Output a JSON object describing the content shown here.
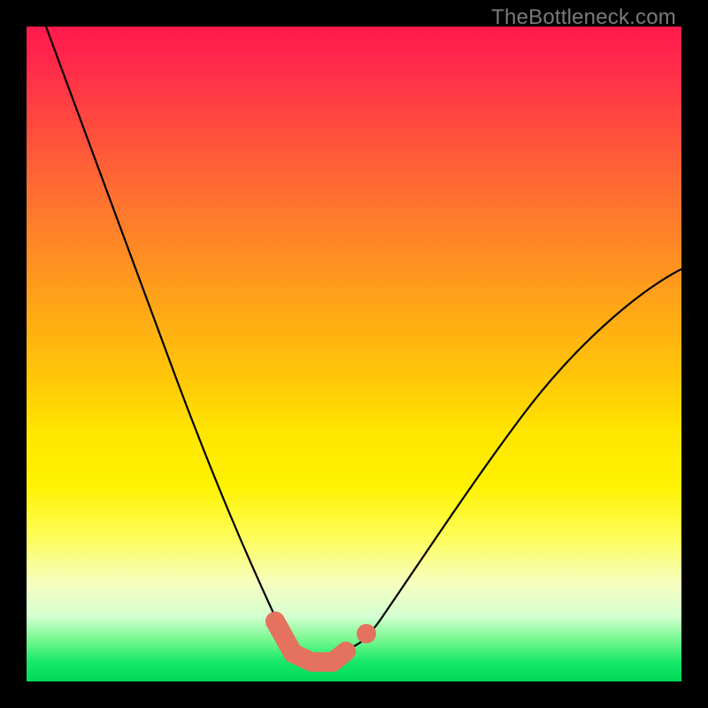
{
  "watermark": "TheBottleneck.com",
  "colors": {
    "frame": "#000000",
    "gradient_top": "#ff1a4d",
    "gradient_bottom": "#00d856",
    "curve": "#000000",
    "marker": "#e4725f"
  },
  "chart_data": {
    "type": "line",
    "title": "",
    "xlabel": "",
    "ylabel": "",
    "xlim": [
      0,
      100
    ],
    "ylim": [
      0,
      100
    ],
    "grid": false,
    "legend": false,
    "series": [
      {
        "name": "left-branch",
        "x": [
          3,
          8,
          12,
          16,
          20,
          24,
          28,
          32,
          36,
          40,
          41
        ],
        "values": [
          100,
          87,
          76,
          65,
          54,
          43,
          32,
          21,
          12,
          6,
          5
        ]
      },
      {
        "name": "right-branch",
        "x": [
          49,
          52,
          56,
          60,
          66,
          72,
          78,
          84,
          90,
          96,
          100
        ],
        "values": [
          5,
          7,
          11,
          17,
          26,
          35,
          43,
          50,
          56,
          61,
          63
        ]
      },
      {
        "name": "marker-segment",
        "x": [
          38,
          41,
          43,
          47,
          49,
          50
        ],
        "values": [
          9,
          4,
          3,
          3,
          5,
          7
        ]
      }
    ],
    "annotations": [
      {
        "text": "TheBottleneck.com",
        "position": "top-right"
      }
    ]
  }
}
